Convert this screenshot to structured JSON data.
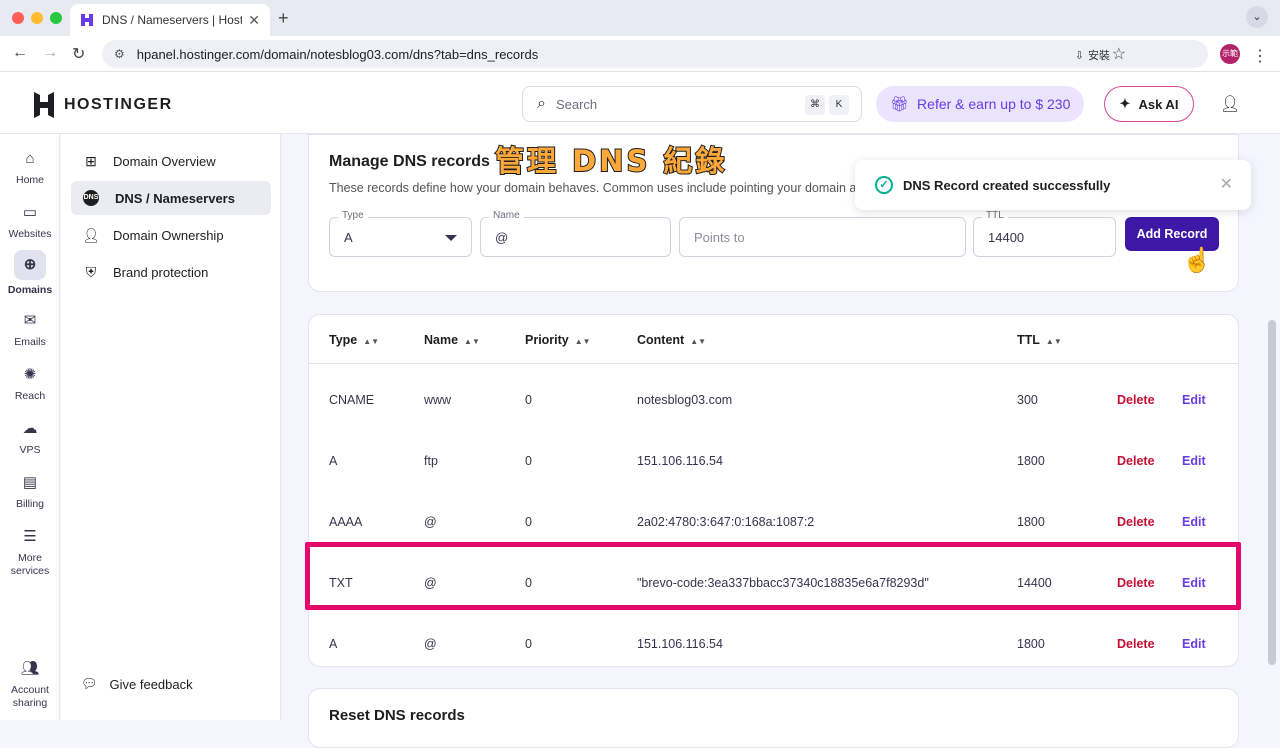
{
  "browser": {
    "tab_title": "DNS / Nameservers | Hostinger",
    "url": "hpanel.hostinger.com/domain/notesblog03.com/dns?tab=dns_records",
    "install_label": "安裝",
    "profile_label": "示範"
  },
  "header": {
    "logo": "HOSTINGER",
    "search_placeholder": "Search",
    "search_key1": "⌘",
    "search_key2": "K",
    "refer_label": "Refer & earn up to $ 230",
    "ask_ai_label": "Ask AI"
  },
  "rail": [
    {
      "label": "Home"
    },
    {
      "label": "Websites"
    },
    {
      "label": "Domains"
    },
    {
      "label": "Emails"
    },
    {
      "label": "Reach"
    },
    {
      "label": "VPS"
    },
    {
      "label": "Billing"
    },
    {
      "label": "More services"
    },
    {
      "label": "Account sharing"
    }
  ],
  "subnav": {
    "items": [
      {
        "label": "Domain Overview"
      },
      {
        "label": "DNS / Nameservers"
      },
      {
        "label": "Domain Ownership"
      },
      {
        "label": "Brand protection"
      }
    ],
    "feedback": "Give feedback",
    "dns_badge": "DNS"
  },
  "manage": {
    "title": "Manage DNS records",
    "overlay_title": "管理 DNS 紀錄",
    "description": "These records define how your domain behaves. Common uses include pointing your domain at",
    "type_label": "Type",
    "type_value": "A",
    "name_label": "Name",
    "name_value": "@",
    "points_placeholder": "Points to",
    "ttl_label": "TTL",
    "ttl_value": "14400",
    "add_button": "Add Record"
  },
  "toast": {
    "message": "DNS Record created successfully"
  },
  "table": {
    "headers": {
      "type": "Type",
      "name": "Name",
      "priority": "Priority",
      "content": "Content",
      "ttl": "TTL"
    },
    "delete_label": "Delete",
    "edit_label": "Edit",
    "rows": [
      {
        "type": "CNAME",
        "name": "www",
        "priority": "0",
        "content": "notesblog03.com",
        "ttl": "300"
      },
      {
        "type": "A",
        "name": "ftp",
        "priority": "0",
        "content": "151.106.116.54",
        "ttl": "1800"
      },
      {
        "type": "AAAA",
        "name": "@",
        "priority": "0",
        "content": "2a02:4780:3:647:0:168a:1087:2",
        "ttl": "1800"
      },
      {
        "type": "TXT",
        "name": "@",
        "priority": "0",
        "content": "\"brevo-code:3ea337bbacc37340c18835e6a7f8293d\"",
        "ttl": "14400"
      },
      {
        "type": "A",
        "name": "@",
        "priority": "0",
        "content": "151.106.116.54",
        "ttl": "1800"
      }
    ]
  },
  "reset": {
    "title": "Reset DNS records"
  },
  "colors": {
    "brand": "#673de6",
    "primary_button": "#3d17a6",
    "delete": "#c51036",
    "highlight": "#e5096e",
    "overlay_text": "#ffa83a"
  }
}
